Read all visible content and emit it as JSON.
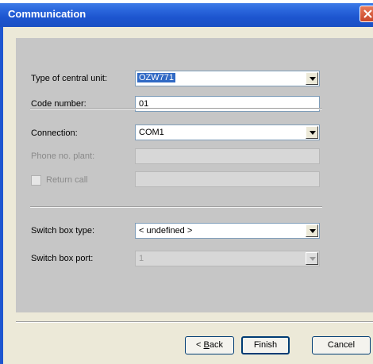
{
  "window": {
    "title": "Communication"
  },
  "form": {
    "central_unit": {
      "label": "Type of central unit:",
      "value": "OZW771"
    },
    "code_number": {
      "label": "Code number:",
      "value": "01"
    },
    "connection": {
      "label": "Connection:",
      "value": "COM1"
    },
    "phone": {
      "label": "Phone no. plant:",
      "value": ""
    },
    "return_call": {
      "label": "Return call",
      "checked": false,
      "value": ""
    },
    "switch_box_type": {
      "label": "Switch box type:",
      "value": "< undefined >"
    },
    "switch_box_port": {
      "label": "Switch box port:",
      "value": "1"
    }
  },
  "buttons": {
    "back_prefix": "< ",
    "back_underlined": "B",
    "back_rest": "ack",
    "finish": "Finish",
    "cancel": "Cancel"
  },
  "colors": {
    "titlebar": "#1d55cf",
    "panel": "#c6c6c6",
    "selection": "#316ac5"
  }
}
